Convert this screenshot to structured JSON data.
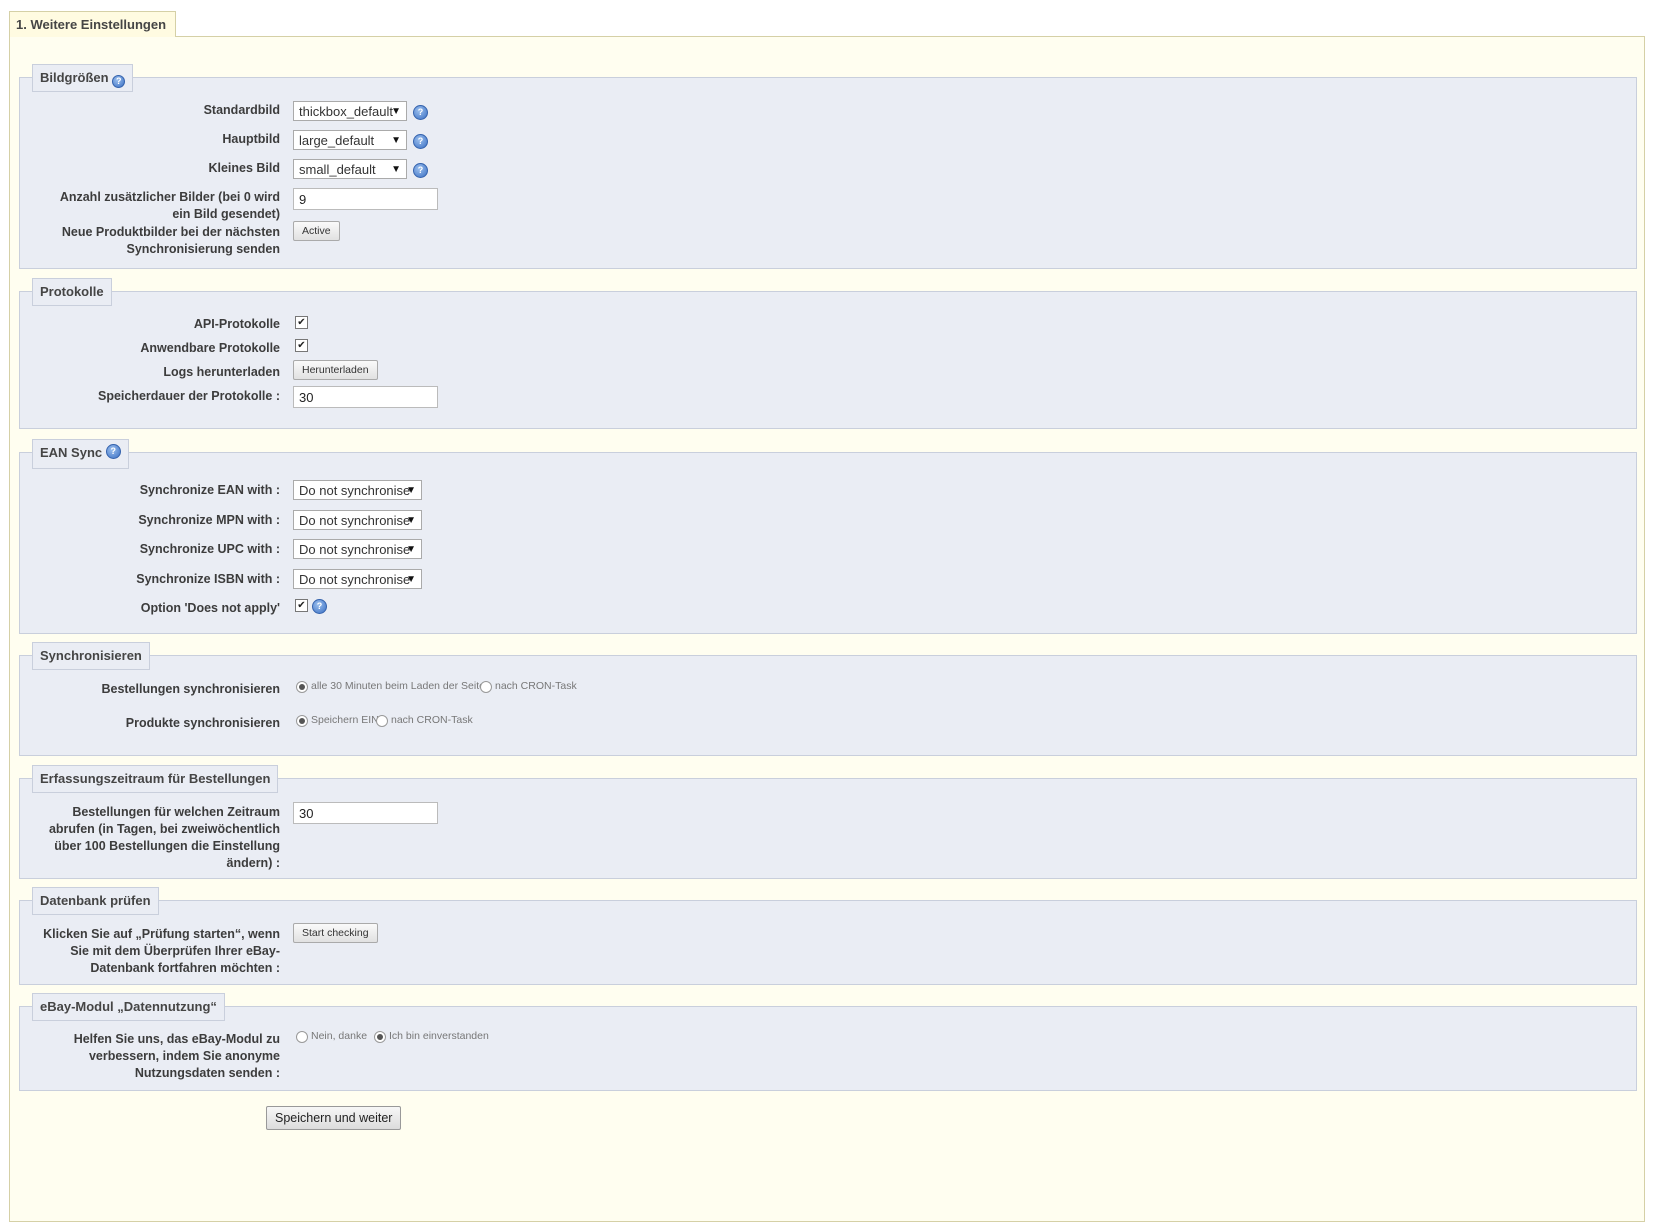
{
  "tab_title": "1. Weitere Einstellungen",
  "sections": {
    "bildgroessen": {
      "legend": "Bildgrößen",
      "standardbild": {
        "label": "Standardbild",
        "value": "thickbox_default"
      },
      "hauptbild": {
        "label": "Hauptbild",
        "value": "large_default"
      },
      "kleines_bild": {
        "label": "Kleines Bild",
        "value": "small_default"
      },
      "anzahl": {
        "label": "Anzahl zusätzlicher Bilder (bei 0 wird ein Bild gesendet)",
        "value": "9"
      },
      "neue_bilder": {
        "label": "Neue Produktbilder bei der nächsten Synchronisierung senden",
        "button": "Active"
      }
    },
    "protokolle": {
      "legend": "Protokolle",
      "api": {
        "label": "API-Protokolle",
        "checked": true
      },
      "anwendbare": {
        "label": "Anwendbare Protokolle",
        "checked": true
      },
      "logs": {
        "label": "Logs herunterladen",
        "button": "Herunterladen"
      },
      "speicherdauer": {
        "label": "Speicherdauer der Protokolle :",
        "value": "30"
      }
    },
    "ean": {
      "legend": "EAN Sync",
      "ean": {
        "label": "Synchronize EAN with :",
        "value": "Do not synchronise"
      },
      "mpn": {
        "label": "Synchronize MPN with :",
        "value": "Do not synchronise"
      },
      "upc": {
        "label": "Synchronize UPC with :",
        "value": "Do not synchronise"
      },
      "isbn": {
        "label": "Synchronize ISBN with :",
        "value": "Do not synchronise"
      },
      "option": {
        "label": "Option 'Does not apply'",
        "checked": true
      }
    },
    "sync": {
      "legend": "Synchronisieren",
      "bestellungen": {
        "label": "Bestellungen synchronisieren",
        "opt1": "alle 30 Minuten beim Laden der Seite",
        "opt2": "nach CRON-Task"
      },
      "produkte": {
        "label": "Produkte synchronisieren",
        "opt1": "Speichern EIN",
        "opt2": "nach CRON-Task"
      }
    },
    "zeitraum": {
      "legend": "Erfassungszeitraum für Bestellungen",
      "label": "Bestellungen für welchen Zeitraum abrufen (in Tagen, bei zweiwöchentlich über 100 Bestellungen die Einstellung ändern) :",
      "value": "30"
    },
    "datenbank": {
      "legend": "Datenbank prüfen",
      "label": "Klicken Sie auf „Prüfung starten“, wenn Sie mit dem Überprüfen Ihrer eBay-Datenbank fortfahren möchten :",
      "button": "Start checking"
    },
    "datennutzung": {
      "legend": "eBay-Modul „Datennutzung“",
      "label": "Helfen Sie uns, das eBay-Modul zu verbessern, indem Sie anonyme Nutzungsdaten senden :",
      "opt1": "Nein, danke",
      "opt2": "Ich bin einverstanden"
    }
  },
  "save_button": "Speichern und weiter",
  "icons": {
    "help": "help-icon",
    "checkmark": "✔",
    "arrow": "▼"
  }
}
